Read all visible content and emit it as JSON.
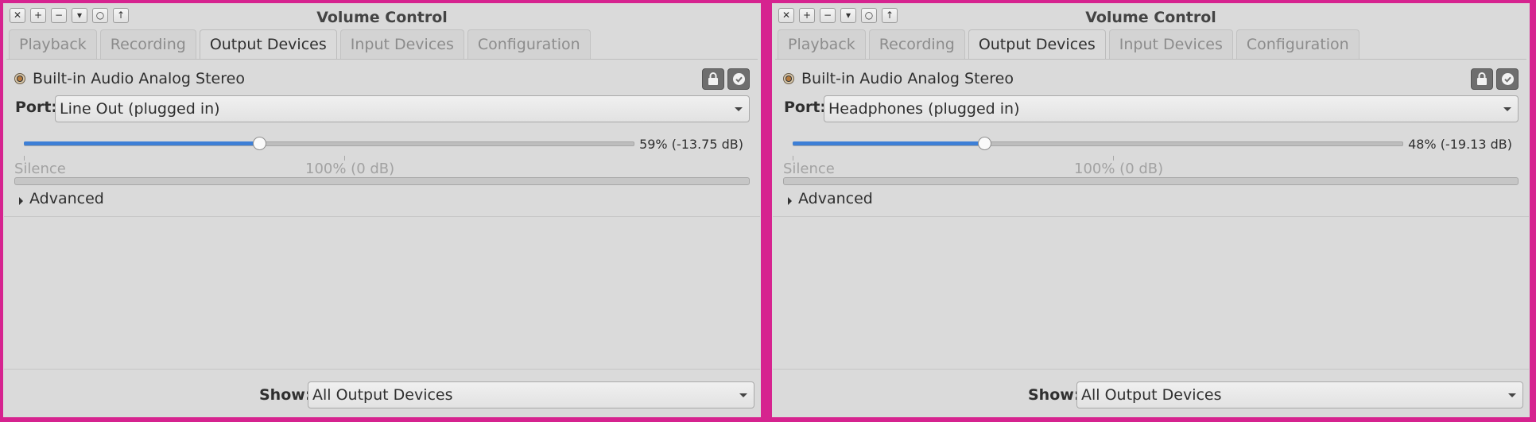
{
  "windows": [
    {
      "title": "Volume Control",
      "wm_buttons": [
        "✕",
        "+",
        "−",
        "▾",
        "○",
        "↑"
      ],
      "tabs": [
        "Playback",
        "Recording",
        "Output Devices",
        "Input Devices",
        "Configuration"
      ],
      "active_tab": "Output Devices",
      "device": {
        "name": "Built-in Audio Analog Stereo",
        "port_label": "Port:",
        "port_value": "Line Out (plugged in)",
        "volume_fraction": 0.59,
        "volume_text": "59% (-13.75 dB)",
        "silence_label": "Silence",
        "reference_label": "100% (0 dB)",
        "advanced_label": "Advanced"
      },
      "show_label": "Show:",
      "show_value": "All Output Devices"
    },
    {
      "title": "Volume Control",
      "wm_buttons": [
        "✕",
        "+",
        "−",
        "▾",
        "○",
        "↑"
      ],
      "tabs": [
        "Playback",
        "Recording",
        "Output Devices",
        "Input Devices",
        "Configuration"
      ],
      "active_tab": "Output Devices",
      "device": {
        "name": "Built-in Audio Analog Stereo",
        "port_label": "Port:",
        "port_value": "Headphones (plugged in)",
        "volume_fraction": 0.48,
        "volume_text": "48% (-19.13 dB)",
        "silence_label": "Silence",
        "reference_label": "100% (0 dB)",
        "advanced_label": "Advanced"
      },
      "show_label": "Show:",
      "show_value": "All Output Devices"
    }
  ],
  "colors": {
    "accent": "#3d7fd6",
    "frame": "#d6238f",
    "window_bg": "#dadada"
  },
  "icons": {
    "close": "close-icon",
    "lock": "lock-icon",
    "default": "check-circle-icon",
    "device": "speaker-icon"
  }
}
